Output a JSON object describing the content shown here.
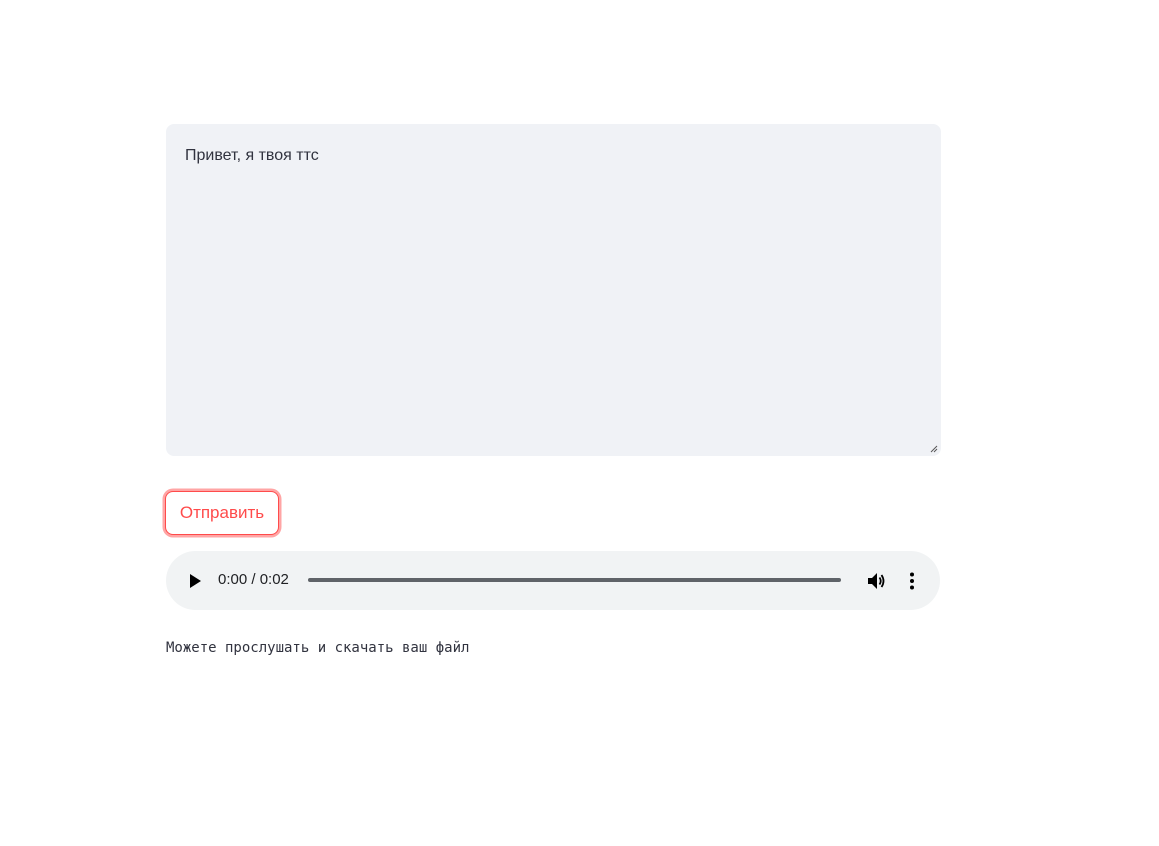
{
  "text_input": {
    "value": "Привет, я твоя ттс"
  },
  "send_button": {
    "label": "Отправить"
  },
  "audio_player": {
    "time": "0:00 / 0:02",
    "progress": 0.0,
    "icons": {
      "play": "play-icon",
      "volume": "volume-icon",
      "more": "more-options-icon"
    }
  },
  "caption": {
    "text": "Можете прослушать и скачать ваш файл"
  },
  "colors": {
    "accent": "#ff4b4b",
    "input_bg": "#f0f2f6",
    "player_bg": "#f1f3f4",
    "text": "#31333f"
  }
}
